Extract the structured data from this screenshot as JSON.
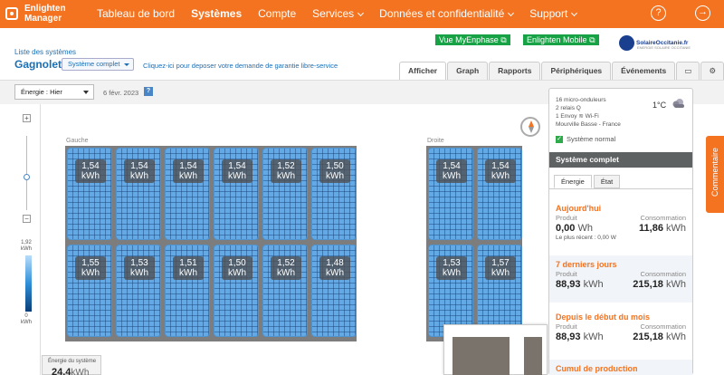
{
  "header": {
    "logo_line1": "Enlighten",
    "logo_line2": "Manager",
    "nav": [
      {
        "label": "Tableau de bord"
      },
      {
        "label": "Systèmes"
      },
      {
        "label": "Compte"
      },
      {
        "label": "Services"
      },
      {
        "label": "Données et confidentialité"
      },
      {
        "label": "Support"
      }
    ]
  },
  "subheader": {
    "breadcrumb": "Liste des systèmes",
    "site_name": "Gagnolet",
    "view": "Système complet",
    "warranty_link": "Cliquez-ici pour deposer votre demande de garantie libre-service",
    "btn_myenphase": "Vue MyEnphase",
    "btn_mobile": "Enlighten Mobile",
    "brand": "SolaireOccitanie.fr",
    "brand_sub": "ENERGIE SOLAIRE OCCITANIE"
  },
  "tabs": [
    "Afficher",
    "Graph",
    "Rapports",
    "Périphériques",
    "Événements"
  ],
  "toolbar": {
    "energy": "Énergie : Hier",
    "date": "6 févr. 2023",
    "help": "?"
  },
  "legend": {
    "max_value": "1,92",
    "max_unit": "kWh",
    "min_value": "0",
    "min_unit": "kWh"
  },
  "array": {
    "left_label": "Gauche",
    "right_label": "Droite",
    "unit": "kWh",
    "left_panels": [
      "1,54",
      "1,54",
      "1,54",
      "1,54",
      "1,52",
      "1,50",
      "1,55",
      "1,53",
      "1,51",
      "1,50",
      "1,52",
      "1,48"
    ],
    "right_panels": [
      "1,54",
      "1,54",
      "1,53",
      "1,57"
    ]
  },
  "production": {
    "label": "Énergie du système",
    "value": "24,4",
    "unit": "kWh"
  },
  "side": {
    "line1": "16 micro-onduleurs",
    "line2": "2 relais Q",
    "line3": "1 Envoy",
    "wifi": "Wi-Fi",
    "line4": "Mourville Basse - France",
    "temp": "1°C",
    "status": "Système normal",
    "section_title": "Système complet",
    "sub_tabs": [
      "Énergie",
      "État"
    ],
    "stats": {
      "today": {
        "title": "Aujourd'hui",
        "prod_label": "Produit",
        "cons_label": "Consommation",
        "prod": "0,00",
        "prod_unit": "Wh",
        "cons": "11,86",
        "cons_unit": "kWh",
        "note": "Le plus récent : 0,00 W"
      },
      "week": {
        "title": "7 derniers jours",
        "prod_label": "Produit",
        "cons_label": "Consommation",
        "prod": "88,93",
        "prod_unit": "kWh",
        "cons": "215,18",
        "cons_unit": "kWh"
      },
      "month": {
        "title": "Depuis le début du mois",
        "prod_label": "Produit",
        "cons_label": "Consommation",
        "prod": "88,93",
        "prod_unit": "kWh",
        "cons": "215,18",
        "cons_unit": "kWh"
      },
      "cumul": {
        "title": "Cumul de production"
      }
    }
  },
  "feedback": "Commentaire"
}
